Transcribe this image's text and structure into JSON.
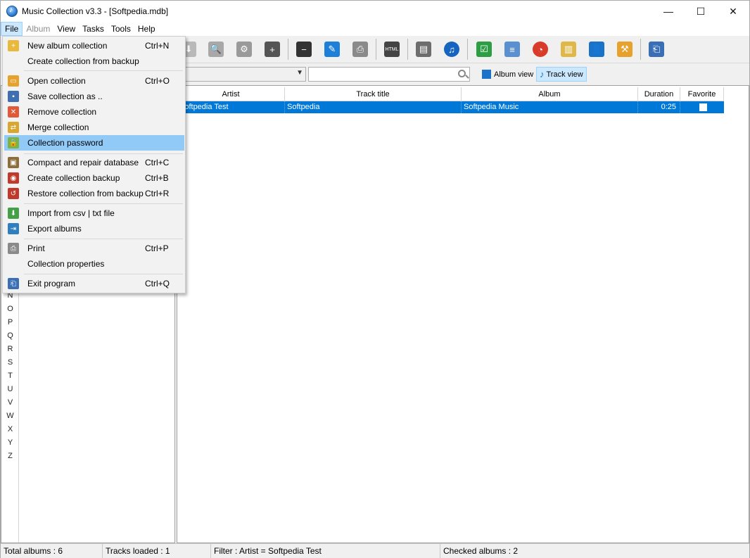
{
  "window": {
    "title": "Music Collection v3.3 - [Softpedia.mdb]",
    "controls": [
      "—",
      "☐",
      "✕"
    ]
  },
  "menubar": {
    "items": [
      "File",
      "Album",
      "View",
      "Tasks",
      "Tools",
      "Help"
    ]
  },
  "file_menu": {
    "items": [
      {
        "label": "New album collection",
        "shortcut": "Ctrl+N",
        "icon": "new-collection-icon"
      },
      {
        "label": "Create collection from backup",
        "shortcut": "",
        "icon": ""
      },
      {
        "label": "Open collection",
        "shortcut": "Ctrl+O",
        "icon": "open-folder-icon"
      },
      {
        "label": "Save collection as ..",
        "shortcut": "",
        "icon": "save-icon"
      },
      {
        "label": "Remove collection",
        "shortcut": "",
        "icon": "remove-icon"
      },
      {
        "label": "Merge collection",
        "shortcut": "",
        "icon": "merge-icon"
      },
      {
        "label": "Collection password",
        "shortcut": "",
        "icon": "password-icon"
      },
      {
        "label": "Compact and repair database",
        "shortcut": "Ctrl+C",
        "icon": "compact-icon"
      },
      {
        "label": "Create collection backup",
        "shortcut": "Ctrl+B",
        "icon": "backup-icon"
      },
      {
        "label": "Restore collection from backup",
        "shortcut": "Ctrl+R",
        "icon": "restore-icon"
      },
      {
        "label": "Import from csv | txt file",
        "shortcut": "",
        "icon": "import-icon"
      },
      {
        "label": "Export albums",
        "shortcut": "",
        "icon": "export-icon"
      },
      {
        "label": "Print",
        "shortcut": "Ctrl+P",
        "icon": "print-icon"
      },
      {
        "label": "Collection properties",
        "shortcut": "",
        "icon": ""
      },
      {
        "label": "Exit program",
        "shortcut": "Ctrl+Q",
        "icon": "exit-icon"
      }
    ]
  },
  "filterbar": {
    "album_view": "Album view",
    "track_view": "Track view"
  },
  "letters": [
    "N",
    "O",
    "P",
    "Q",
    "R",
    "S",
    "T",
    "U",
    "V",
    "W",
    "X",
    "Y",
    "Z"
  ],
  "table": {
    "columns": [
      "Artist",
      "Track title",
      "Album",
      "Duration",
      "Favorite"
    ],
    "rows": [
      {
        "artist": "Softpedia Test",
        "track": "Softpedia",
        "album": "Softpedia Music",
        "duration": "0:25"
      }
    ]
  },
  "status": {
    "total_albums": "Total albums : 6",
    "tracks_loaded": "Tracks loaded : 1",
    "filter": "Filter : Artist = Softpedia Test",
    "checked": "Checked albums : 2"
  },
  "colors": {
    "selection": "#0078d7",
    "menu_highlight": "#91c9f7"
  }
}
